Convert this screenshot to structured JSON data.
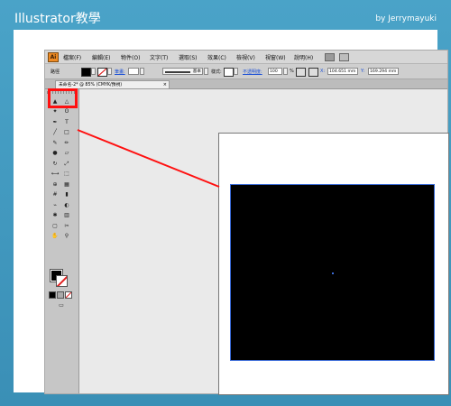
{
  "header": {
    "title": "Illustrator教學",
    "author": "by Jerrymayuki"
  },
  "app": {
    "logo": "Ai",
    "menu": [
      "檔案(F)",
      "編輯(E)",
      "物件(O)",
      "文字(T)",
      "選取(S)",
      "效果(C)",
      "檢視(V)",
      "視窗(W)",
      "說明(H)"
    ],
    "control_bar": {
      "label": "路徑",
      "stroke_link": "筆畫:",
      "stroke_style": "基本",
      "style_label": "樣式:",
      "opacity_link": "不透明度:",
      "opacity_value": "100",
      "opacity_unit": "%",
      "x_label": "X:",
      "x_value": "104.651 mm",
      "y_label": "Y:",
      "y_value": "169.294 mm"
    },
    "document_tab": {
      "label": "未命名-2* @ 85% (CMYK/預視)",
      "close": "×"
    }
  },
  "colors": {
    "banner": "#4aa3c8",
    "highlight": "#ff1010",
    "artwork_fill": "#000000",
    "selection": "#3b6bd6",
    "app_icon": "#ef8b24"
  },
  "toolbox": {
    "tools": [
      "selection-tool",
      "direct-selection-tool",
      "magic-wand-tool",
      "lasso-tool",
      "pen-tool",
      "type-tool",
      "line-segment-tool",
      "rectangle-tool",
      "paintbrush-tool",
      "pencil-tool",
      "blob-brush-tool",
      "eraser-tool",
      "rotate-tool",
      "scale-tool",
      "width-tool",
      "free-transform-tool",
      "shape-builder-tool",
      "perspective-grid-tool",
      "mesh-tool",
      "gradient-tool",
      "eyedropper-tool",
      "blend-tool",
      "symbol-sprayer-tool",
      "column-graph-tool",
      "artboard-tool",
      "slice-tool",
      "hand-tool",
      "zoom-tool"
    ],
    "fill_color": "#000000",
    "stroke_color": "none"
  }
}
